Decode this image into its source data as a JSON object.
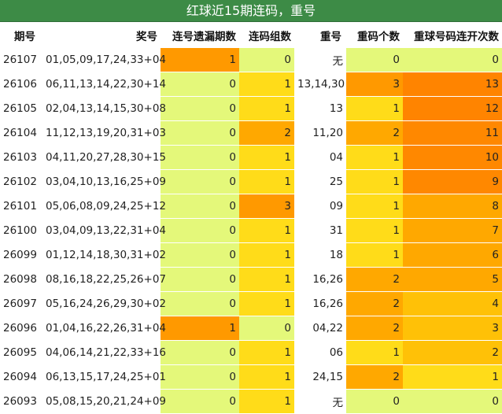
{
  "title": "红球近15期连码，重号",
  "headers": [
    "期号",
    "奖号",
    "连号遗漏期数",
    "连码组数",
    "重号",
    "重码个数",
    "重球号码连开次数"
  ],
  "colors": {
    "title_bg": "#3d8b46",
    "lime": "#e4f87a",
    "yellow": "#ffdc19",
    "orange_light": "#ffc107",
    "orange_mid": "#ffa800",
    "orange": "#ff9900",
    "orange_dark": "#ff8800",
    "deep_orange": "#ff8400"
  },
  "rows": [
    {
      "period": "26107",
      "numbers": "01,05,09,17,24,33+04",
      "miss": "1",
      "groups": "0",
      "repeat": "无",
      "rep_count": "0",
      "streak": "0"
    },
    {
      "period": "26106",
      "numbers": "06,11,13,14,22,30+14",
      "miss": "0",
      "groups": "1",
      "repeat": "13,14,30",
      "rep_count": "3",
      "streak": "13"
    },
    {
      "period": "26105",
      "numbers": "02,04,13,14,15,30+08",
      "miss": "0",
      "groups": "1",
      "repeat": "13",
      "rep_count": "1",
      "streak": "12"
    },
    {
      "period": "26104",
      "numbers": "11,12,13,19,20,31+03",
      "miss": "0",
      "groups": "2",
      "repeat": "11,20",
      "rep_count": "2",
      "streak": "11"
    },
    {
      "period": "26103",
      "numbers": "04,11,20,27,28,30+15",
      "miss": "0",
      "groups": "1",
      "repeat": "04",
      "rep_count": "1",
      "streak": "10"
    },
    {
      "period": "26102",
      "numbers": "03,04,10,13,16,25+09",
      "miss": "0",
      "groups": "1",
      "repeat": "25",
      "rep_count": "1",
      "streak": "9"
    },
    {
      "period": "26101",
      "numbers": "05,06,08,09,24,25+12",
      "miss": "0",
      "groups": "3",
      "repeat": "09",
      "rep_count": "1",
      "streak": "8"
    },
    {
      "period": "26100",
      "numbers": "03,04,09,13,22,31+04",
      "miss": "0",
      "groups": "1",
      "repeat": "31",
      "rep_count": "1",
      "streak": "7"
    },
    {
      "period": "26099",
      "numbers": "01,12,14,18,30,31+02",
      "miss": "0",
      "groups": "1",
      "repeat": "18",
      "rep_count": "1",
      "streak": "6"
    },
    {
      "period": "26098",
      "numbers": "08,16,18,22,25,26+07",
      "miss": "0",
      "groups": "1",
      "repeat": "16,26",
      "rep_count": "2",
      "streak": "5"
    },
    {
      "period": "26097",
      "numbers": "05,16,24,26,29,30+02",
      "miss": "0",
      "groups": "1",
      "repeat": "16,26",
      "rep_count": "2",
      "streak": "4"
    },
    {
      "period": "26096",
      "numbers": "01,04,16,22,26,31+04",
      "miss": "1",
      "groups": "0",
      "repeat": "04,22",
      "rep_count": "2",
      "streak": "3"
    },
    {
      "period": "26095",
      "numbers": "04,06,14,21,22,33+16",
      "miss": "0",
      "groups": "1",
      "repeat": "06",
      "rep_count": "1",
      "streak": "2"
    },
    {
      "period": "26094",
      "numbers": "06,13,15,17,24,25+01",
      "miss": "0",
      "groups": "1",
      "repeat": "24,15",
      "rep_count": "2",
      "streak": "1"
    },
    {
      "period": "26093",
      "numbers": "05,08,15,20,21,24+09",
      "miss": "0",
      "groups": "1",
      "repeat": "无",
      "rep_count": "0",
      "streak": "0"
    }
  ]
}
